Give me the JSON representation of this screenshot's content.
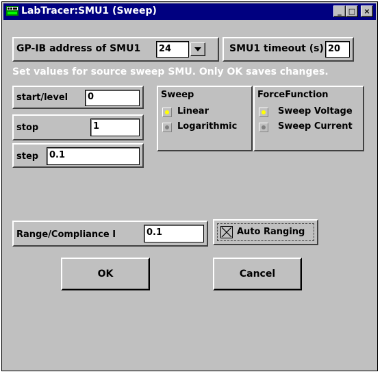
{
  "window": {
    "title": "LabTracer:SMU1 (Sweep)",
    "controls": {
      "minimize": "_",
      "maximize": "□",
      "close": "×"
    }
  },
  "gpib": {
    "label": "GP-IB address of SMU1",
    "value": "24"
  },
  "timeout": {
    "label": "SMU1 timeout (s)",
    "value": "20"
  },
  "instructions": "Set values for source sweep SMU. Only OK saves changes.",
  "params": {
    "start": {
      "label": "start/level",
      "value": "0"
    },
    "stop": {
      "label": "stop",
      "value": "1"
    },
    "step": {
      "label": "step",
      "value": "0.1"
    }
  },
  "sweep": {
    "title": "Sweep",
    "options": [
      "Linear",
      "Logarithmic"
    ],
    "selected": "Linear"
  },
  "force_function": {
    "title": "ForceFunction",
    "options": [
      "Sweep Voltage",
      "Sweep Current"
    ],
    "selected": "Sweep Voltage"
  },
  "range": {
    "label": "Range/Compliance I",
    "value": "0.1"
  },
  "auto_ranging": {
    "label": "Auto Ranging",
    "checked": true
  },
  "buttons": {
    "ok": "OK",
    "cancel": "Cancel"
  },
  "colors": {
    "title_bar": "#000080",
    "face": "#c0c0c0",
    "radio_selected": "#ffff00",
    "radio_unselected": "#808080"
  },
  "icons": {
    "app": "labtracer-app-icon",
    "combo": "chevron-down-icon",
    "checkbox": "x-check-icon"
  }
}
